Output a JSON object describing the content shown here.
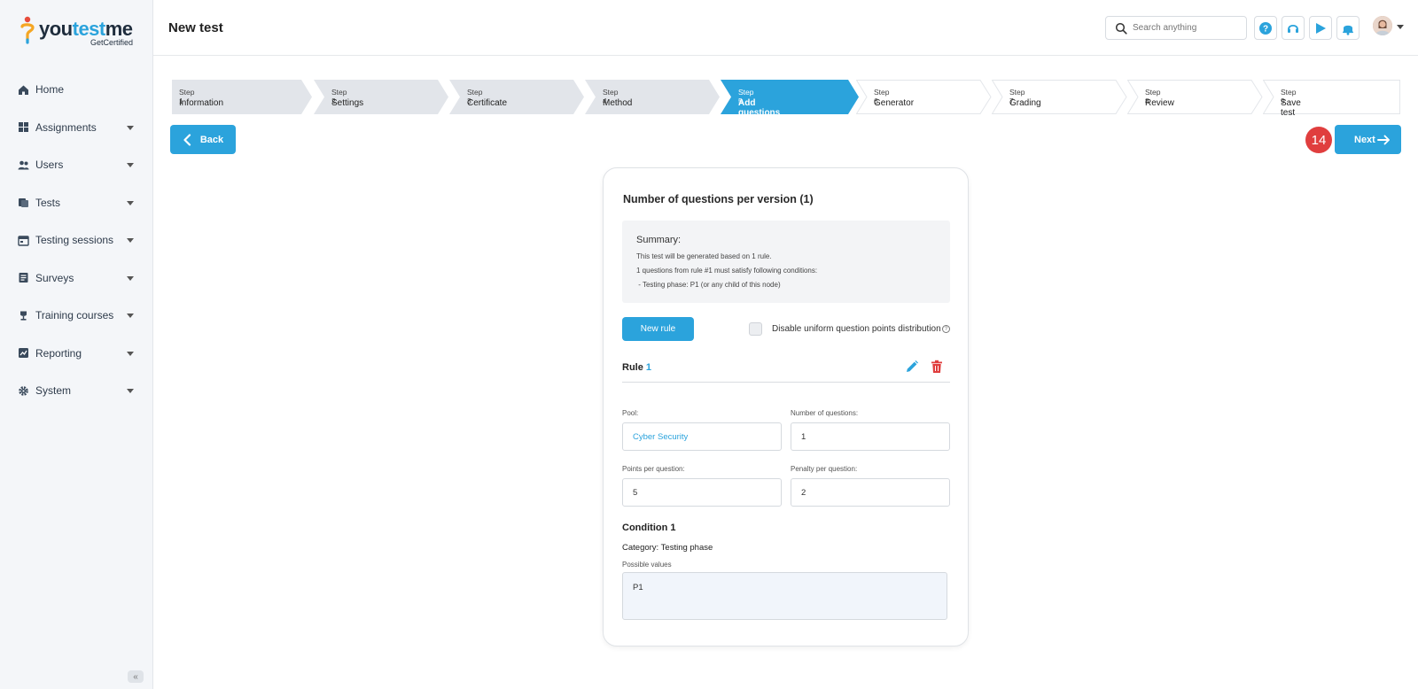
{
  "brand": {
    "name_part1": "you",
    "name_part2": "test",
    "name_part3": "me",
    "tagline": "GetCertified"
  },
  "sidebar": {
    "items": [
      {
        "label": "Home",
        "icon": "home-icon",
        "has_caret": false
      },
      {
        "label": "Assignments",
        "icon": "assignments-icon",
        "has_caret": true
      },
      {
        "label": "Users",
        "icon": "users-icon",
        "has_caret": true
      },
      {
        "label": "Tests",
        "icon": "tests-icon",
        "has_caret": true
      },
      {
        "label": "Testing sessions",
        "icon": "calendar-icon",
        "has_caret": true
      },
      {
        "label": "Surveys",
        "icon": "surveys-icon",
        "has_caret": true
      },
      {
        "label": "Training courses",
        "icon": "trophy-icon",
        "has_caret": true
      },
      {
        "label": "Reporting",
        "icon": "reporting-icon",
        "has_caret": true
      },
      {
        "label": "System",
        "icon": "gear-icon",
        "has_caret": true
      }
    ],
    "collapse_glyph": "«"
  },
  "header": {
    "title": "New test",
    "search_placeholder": "Search anything",
    "icons": [
      "help-icon",
      "headset-icon",
      "play-icon",
      "bell-icon"
    ]
  },
  "stepper": {
    "steps": [
      {
        "num": "Step 1",
        "name": "Information",
        "state": "done"
      },
      {
        "num": "Step 2",
        "name": "Settings",
        "state": "done"
      },
      {
        "num": "Step 3",
        "name": "Certificate",
        "state": "done"
      },
      {
        "num": "Step 4",
        "name": "Method",
        "state": "done"
      },
      {
        "num": "Step 5",
        "name": "Add questions",
        "state": "active"
      },
      {
        "num": "Step 6",
        "name": "Generator",
        "state": "todo"
      },
      {
        "num": "Step 7",
        "name": "Grading",
        "state": "todo"
      },
      {
        "num": "Step 8",
        "name": "Review",
        "state": "todo"
      },
      {
        "num": "Step 9",
        "name": "Save test",
        "state": "todo"
      }
    ]
  },
  "nav_buttons": {
    "back_label": "Back",
    "next_label": "Next",
    "step_badge": "14"
  },
  "card": {
    "title": "Number of questions per version (1)",
    "summary": {
      "title": "Summary:",
      "lines": [
        "This test will be generated based on 1 rule.",
        "1 questions from rule #1 must satisfy following conditions:",
        " - Testing phase: P1 (or any child of this node)"
      ]
    },
    "new_rule_label": "New rule",
    "disable_uniform_label": "Disable uniform question points distribution",
    "disable_uniform_checked": false,
    "rule": {
      "title_prefix": "Rule",
      "number": "1",
      "pool_label": "Pool:",
      "pool_value": "Cyber Security",
      "num_questions_label": "Number of questions:",
      "num_questions_value": "1",
      "points_label": "Points per question:",
      "points_value": "5",
      "penalty_label": "Penalty per question:",
      "penalty_value": "2"
    },
    "condition": {
      "title": "Condition 1",
      "category": "Category: Testing phase",
      "possible_values_label": "Possible values",
      "possible_values": "P1"
    }
  },
  "colors": {
    "accent": "#2ba3dc",
    "step_done": "#e2e5ea",
    "step_todo": "#ffffff",
    "badge": "#e03e3e",
    "delete": "#e03e3e"
  }
}
